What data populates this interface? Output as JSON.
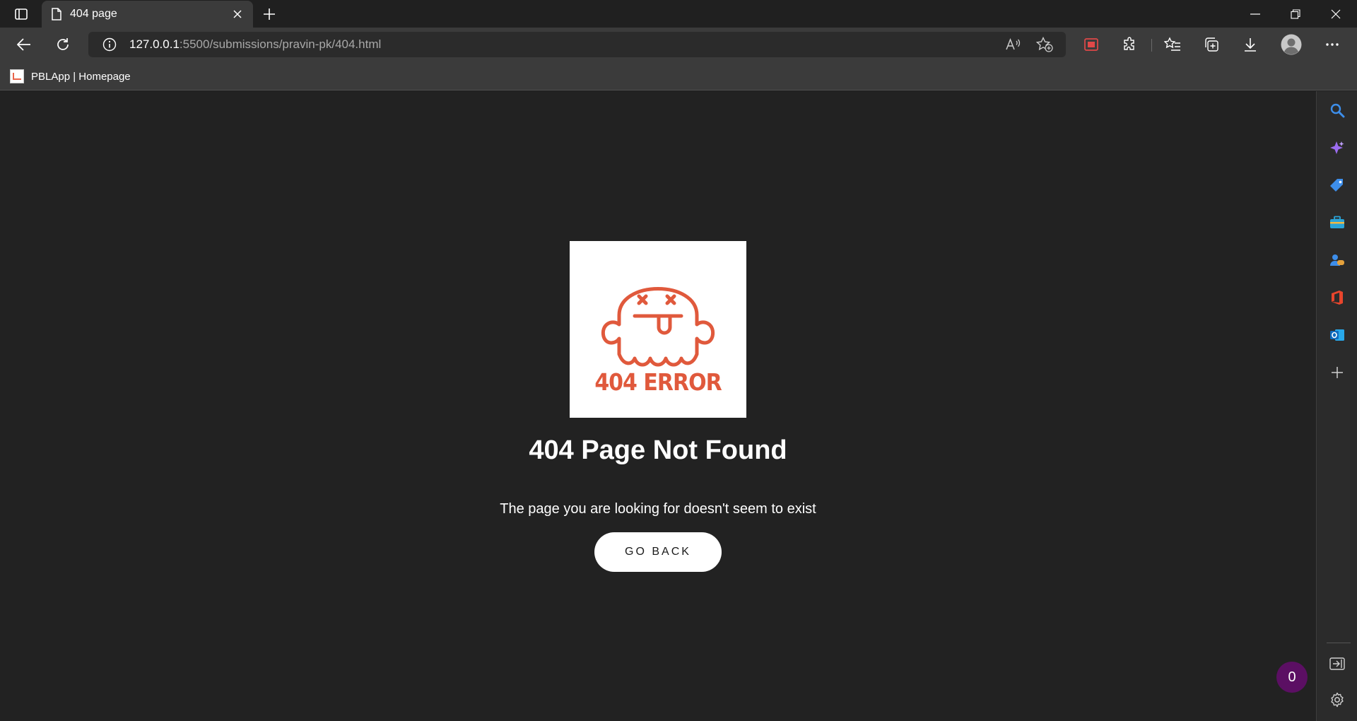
{
  "browser": {
    "tab": {
      "title": "404 page",
      "icon": "document-icon"
    },
    "address_bar": {
      "host": "127.0.0.1",
      "rest": ":5500/submissions/pravin-pk/404.html"
    },
    "favorites": [
      {
        "label": "PBLApp | Homepage",
        "icon": "pblapp-favicon"
      }
    ],
    "toolbar_icons": [
      "back-icon",
      "refresh-icon",
      "site-info-icon",
      "read-aloud-icon",
      "add-favorite-icon",
      "screen-capture-icon",
      "extensions-icon",
      "favorites-icon",
      "collections-icon",
      "downloads-icon",
      "profile-avatar",
      "more-icon"
    ],
    "sidebar_icons": [
      "search-icon",
      "copilot-icon",
      "shopping-icon",
      "tools-icon",
      "games-icon",
      "office-icon",
      "outlook-icon",
      "add-icon",
      "hide-sidebar-icon",
      "settings-icon"
    ]
  },
  "page": {
    "image_caption": "404 ERROR",
    "heading": "404 Page Not Found",
    "message": "The page you are looking for doesn't seem to exist",
    "button_label": "GO BACK",
    "badge_count": "0"
  },
  "colors": {
    "page_background": "#222222",
    "ghost_accent": "#e0593c",
    "badge": "#5b0f63",
    "chrome": "#3b3b3b"
  }
}
